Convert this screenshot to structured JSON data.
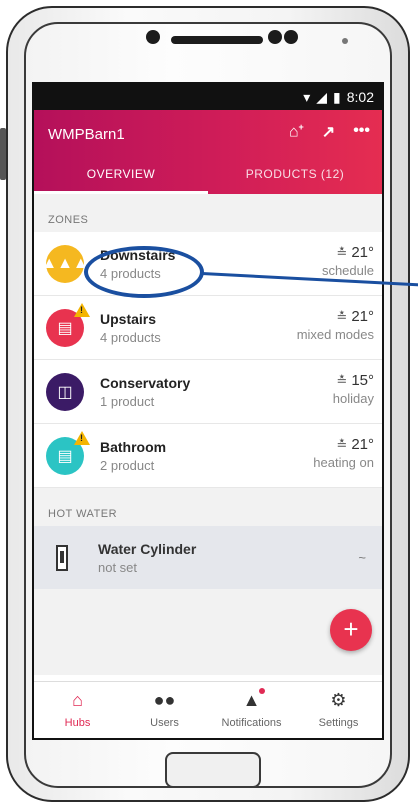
{
  "status_bar": {
    "time": "8:02",
    "wifi_icon": "wifi-icon",
    "signal_icon": "signal-icon",
    "battery_icon": "battery-icon"
  },
  "header": {
    "hub_name": "WMPBarn1",
    "icons": [
      "add-home-icon",
      "chart-icon",
      "more-icon"
    ],
    "tabs": [
      {
        "label": "OVERVIEW",
        "active": true
      },
      {
        "label": "PRODUCTS (12)",
        "active": false
      }
    ],
    "gradient_start": "#b4105a",
    "gradient_end": "#e52d51"
  },
  "zones_section": {
    "label": "ZONES"
  },
  "zones": [
    {
      "name": "Downstairs",
      "sub": "4 products",
      "temp": "21°",
      "mode": "schedule",
      "icon": "heater-icon",
      "color": "#f5b820",
      "warning": false
    },
    {
      "name": "Upstairs",
      "sub": "4 products",
      "temp": "21°",
      "mode": "mixed modes",
      "icon": "bed-icon",
      "color": "#e8334f",
      "warning": true
    },
    {
      "name": "Conservatory",
      "sub": "1 product",
      "temp": "15°",
      "mode": "holiday",
      "icon": "window-icon",
      "color": "#3b1b66",
      "warning": false
    },
    {
      "name": "Bathroom",
      "sub": "2 product",
      "temp": "21°",
      "mode": "heating on",
      "icon": "bathtub-icon",
      "color": "#2bc4c4",
      "warning": true
    }
  ],
  "hot_water_section": {
    "label": "HOT WATER"
  },
  "hot_water": {
    "name": "Water Cylinder",
    "sub": "not set",
    "value": "~",
    "icon": "cylinder-icon"
  },
  "fab": {
    "label": "+"
  },
  "bottom_nav": [
    {
      "label": "Hubs",
      "icon": "home-icon",
      "active": true
    },
    {
      "label": "Users",
      "icon": "users-icon",
      "active": false
    },
    {
      "label": "Notifications",
      "icon": "bell-icon",
      "active": false
    },
    {
      "label": "Settings",
      "icon": "gear-icon",
      "active": false
    }
  ],
  "annotation_color": "#1a4fa0"
}
